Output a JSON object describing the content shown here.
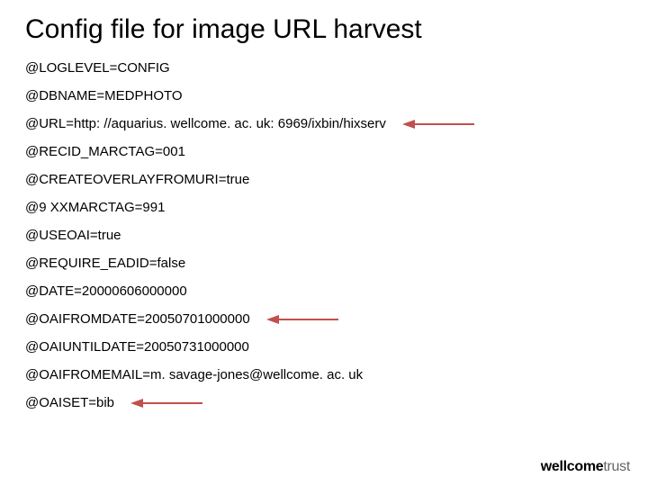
{
  "title": "Config file for image URL harvest",
  "lines": [
    {
      "text": "@LOGLEVEL=CONFIG",
      "arrow": false
    },
    {
      "text": "@DBNAME=MEDPHOTO",
      "arrow": false
    },
    {
      "text": "@URL=http: //aquarius. wellcome. ac. uk: 6969/ixbin/hixserv",
      "arrow": true
    },
    {
      "text": "@RECID_MARCTAG=001",
      "arrow": false
    },
    {
      "text": "@CREATEOVERLAYFROMURI=true",
      "arrow": false
    },
    {
      "text": "@9 XXMARCTAG=991",
      "arrow": false
    },
    {
      "text": "@USEOAI=true",
      "arrow": false
    },
    {
      "text": "@REQUIRE_EADID=false",
      "arrow": false
    },
    {
      "text": "@DATE=20000606000000",
      "arrow": false
    },
    {
      "text": "@OAIFROMDATE=20050701000000",
      "arrow": true
    },
    {
      "text": "@OAIUNTILDATE=20050731000000",
      "arrow": false
    },
    {
      "text": "@OAIFROMEMAIL=m. savage-jones@wellcome. ac. uk",
      "arrow": false
    },
    {
      "text": "@OAISET=bib",
      "arrow": true
    }
  ],
  "arrow_color": "#c0504d",
  "logo": {
    "bold": "wellcome",
    "light": "trust"
  }
}
